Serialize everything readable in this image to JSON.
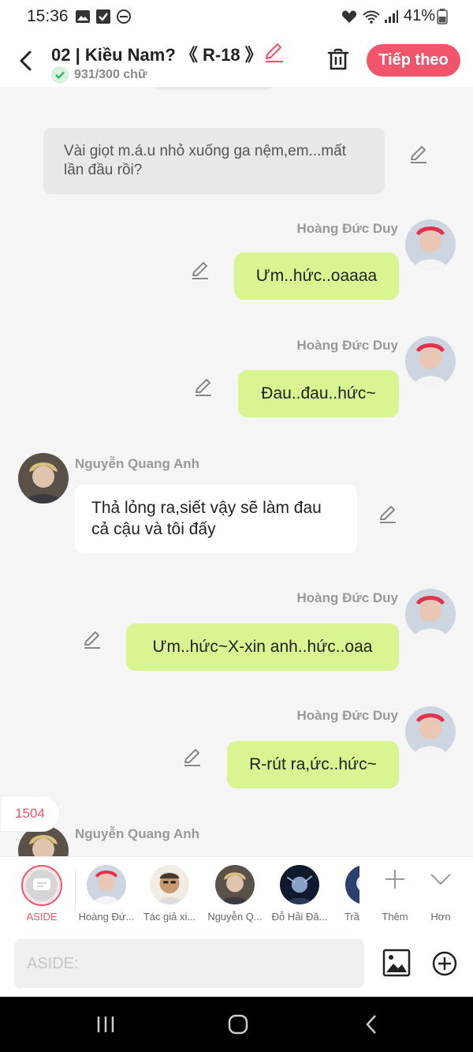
{
  "status_bar": {
    "time": "15:36",
    "battery": "41%"
  },
  "header": {
    "title": "02 | Kiều Nam? 《 R-18 》",
    "word_count": "931/300 chữ",
    "next_label": "Tiếp theo"
  },
  "messages": [
    {
      "type": "narration",
      "text": "Vài giọt m.á.u nhỏ xuống ga nệm,em...mất lần đầu rồi?"
    },
    {
      "type": "right",
      "name": "Hoàng Đức Duy",
      "text": "Ưm..hức..oaaaa"
    },
    {
      "type": "right",
      "name": "Hoàng Đức Duy",
      "text": "Đau..đau..hức~"
    },
    {
      "type": "left",
      "name": "Nguyễn Quang Anh",
      "text": "Thả lỏng ra,siết vậy sẽ làm đau cả cậu và tôi đấy"
    },
    {
      "type": "right",
      "name": "Hoàng Đức Duy",
      "text": "Ưm..hức~X-xin anh..hức..oaa"
    },
    {
      "type": "right",
      "name": "Hoàng Đức Duy",
      "text": "R-rút ra,ức..hức~"
    },
    {
      "type": "left",
      "name": "Nguyễn Quang Anh",
      "text": ""
    }
  ],
  "count_badge": "1504",
  "characters": [
    {
      "label": "ASIDE"
    },
    {
      "label": "Hoàng Đứ..."
    },
    {
      "label": "Tác giả xi..."
    },
    {
      "label": "Nguyễn Q..."
    },
    {
      "label": "Đỗ Hải Đă..."
    },
    {
      "label": "Trầ"
    }
  ],
  "char_bar": {
    "add_label": "Thêm",
    "more_label": "Hơn"
  },
  "input": {
    "placeholder": "ASIDE:"
  },
  "colors": {
    "accent": "#f0556b",
    "bubble_green": "#d8f591",
    "check_green": "#2fbf5a"
  }
}
